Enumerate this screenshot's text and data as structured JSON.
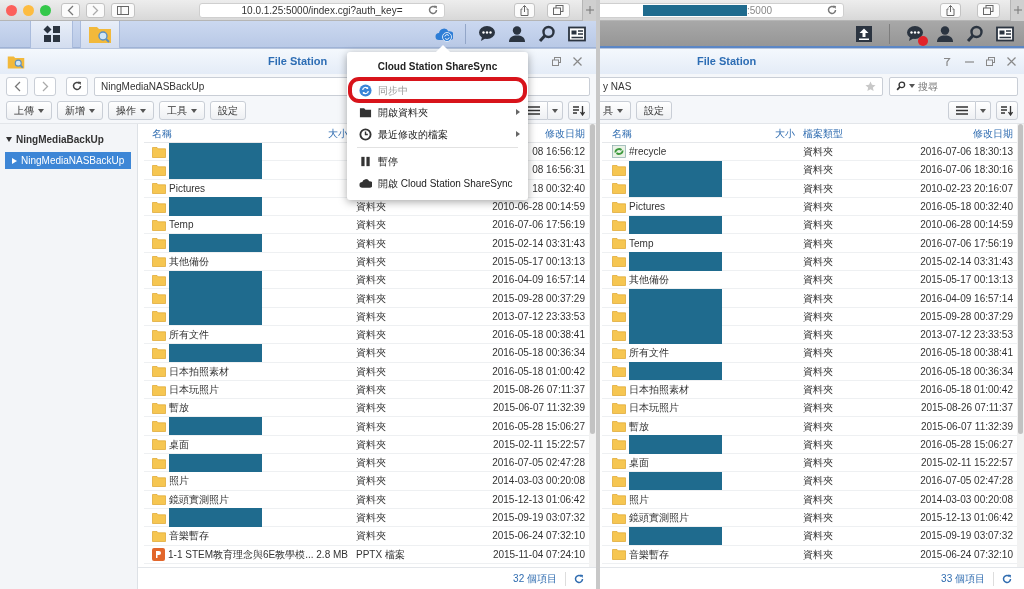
{
  "left_browser": {
    "address": "10.0.1.25:5000/index.cgi?auth_key="
  },
  "left_file_station": {
    "title": "File Station",
    "path": "NingMediaNASBackUp",
    "toolbar": [
      {
        "label": "上傳",
        "dropdown": true
      },
      {
        "label": "新增",
        "dropdown": true
      },
      {
        "label": "操作",
        "dropdown": true
      },
      {
        "label": "工具",
        "dropdown": true
      },
      {
        "label": "設定",
        "dropdown": false
      }
    ],
    "tree": [
      {
        "label": "NingMediaBackUp",
        "expanded": true,
        "selected": false,
        "children": [
          {
            "label": "NingMediaNASBackUp",
            "expanded": false,
            "selected": true
          }
        ]
      }
    ],
    "columns": [
      {
        "kind": "name",
        "label": "名稱"
      },
      {
        "kind": "size",
        "label": "大小"
      },
      {
        "kind": "modified",
        "label": "修改日期"
      }
    ],
    "rows": [
      {
        "kind": "folder",
        "redacted": true,
        "modified": "08 16:56:12"
      },
      {
        "kind": "folder",
        "redacted": true,
        "modified": "08 16:56:31"
      },
      {
        "kind": "folder",
        "redacted": false,
        "name": "Pictures",
        "modified": "18 00:32:40"
      },
      {
        "kind": "folder",
        "redacted": true,
        "type": "資料夾",
        "modified": "2010-06-28 00:14:59"
      },
      {
        "kind": "folder",
        "redacted": false,
        "name": "Temp",
        "type": "資料夾",
        "modified": "2016-07-06 17:56:19"
      },
      {
        "kind": "folder",
        "redacted": true,
        "type": "資料夾",
        "modified": "2015-02-14 03:31:43"
      },
      {
        "kind": "folder",
        "redacted": false,
        "name": "其他備份",
        "type": "資料夾",
        "modified": "2015-05-17 00:13:13"
      },
      {
        "kind": "folder",
        "redacted": true,
        "type": "資料夾",
        "modified": "2016-04-09 16:57:14"
      },
      {
        "kind": "folder",
        "redacted": true,
        "type": "資料夾",
        "modified": "2015-09-28 00:37:29"
      },
      {
        "kind": "folder",
        "redacted": true,
        "type": "資料夾",
        "modified": "2013-07-12 23:33:53"
      },
      {
        "kind": "folder",
        "redacted": false,
        "name": "所有文件",
        "type": "資料夾",
        "modified": "2016-05-18 00:38:41"
      },
      {
        "kind": "folder",
        "redacted": true,
        "type": "資料夾",
        "modified": "2016-05-18 00:36:34"
      },
      {
        "kind": "folder",
        "redacted": false,
        "name": "日本拍照素材",
        "type": "資料夾",
        "modified": "2016-05-18 01:00:42"
      },
      {
        "kind": "folder",
        "redacted": false,
        "name": "日本玩照片",
        "type": "資料夾",
        "modified": "2015-08-26 07:11:37"
      },
      {
        "kind": "folder",
        "redacted": false,
        "name": "暫放",
        "type": "資料夾",
        "modified": "2015-06-07 11:32:39"
      },
      {
        "kind": "folder",
        "redacted": true,
        "type": "資料夾",
        "modified": "2016-05-28 15:06:27"
      },
      {
        "kind": "folder",
        "redacted": false,
        "name": "桌面",
        "type": "資料夾",
        "modified": "2015-02-11 15:22:57"
      },
      {
        "kind": "folder",
        "redacted": true,
        "type": "資料夾",
        "modified": "2016-07-05 02:47:28"
      },
      {
        "kind": "folder",
        "redacted": false,
        "name": "照片",
        "type": "資料夾",
        "modified": "2014-03-03 00:20:08"
      },
      {
        "kind": "folder",
        "redacted": false,
        "name": "鏡頭實測照片",
        "type": "資料夾",
        "modified": "2015-12-13 01:06:42"
      },
      {
        "kind": "folder",
        "redacted": true,
        "type": "資料夾",
        "modified": "2015-09-19 03:07:32"
      },
      {
        "kind": "folder",
        "redacted": false,
        "name": "音樂暫存",
        "type": "資料夾",
        "modified": "2015-06-24 07:32:10"
      },
      {
        "kind": "pptx",
        "redacted": false,
        "name": "1-1 STEM教育理念與6E教學模...",
        "size": "2.8 MB",
        "type": "PPTX 檔案",
        "modified": "2015-11-04 07:24:10"
      }
    ],
    "footer": "32 個項目"
  },
  "sync_menu": {
    "title": "Cloud Station ShareSync",
    "items": [
      {
        "kind": "sync",
        "label": "同步中",
        "disabled": true,
        "highlighted": true,
        "submenu": false
      },
      {
        "kind": "folder",
        "label": "開啟資料夾",
        "disabled": false,
        "highlighted": false,
        "submenu": true
      },
      {
        "kind": "recent",
        "label": "最近修改的檔案",
        "disabled": false,
        "highlighted": false,
        "submenu": true
      },
      {
        "kind": "separator"
      },
      {
        "kind": "pause",
        "label": "暫停",
        "disabled": false,
        "highlighted": false,
        "submenu": false
      },
      {
        "kind": "cloud",
        "label": "開啟 Cloud Station ShareSync",
        "disabled": false,
        "highlighted": false,
        "submenu": false
      }
    ]
  },
  "right_browser": {
    "address": ":5000",
    "address_redacted": true
  },
  "right_taskbar": {
    "notification": true
  },
  "right_file_station": {
    "title": "File Station",
    "path": "y NAS",
    "search_placeholder": "搜尋",
    "toolbar": [
      {
        "label": "具",
        "dropdown": true
      },
      {
        "label": "設定",
        "dropdown": false
      }
    ],
    "columns": [
      {
        "kind": "name",
        "label": "名稱"
      },
      {
        "kind": "size",
        "label": "大小"
      },
      {
        "kind": "type",
        "label": "檔案類型"
      },
      {
        "kind": "modified",
        "label": "修改日期"
      }
    ],
    "rows": [
      {
        "kind": "recycle",
        "redacted": false,
        "name": "#recycle",
        "type": "資料夾",
        "modified": "2016-07-06 18:30:13"
      },
      {
        "kind": "folder",
        "redacted": true,
        "type": "資料夾",
        "modified": "2016-07-06 18:30:16"
      },
      {
        "kind": "folder",
        "redacted": true,
        "type": "資料夾",
        "modified": "2010-02-23 20:16:07"
      },
      {
        "kind": "folder",
        "redacted": false,
        "name": "Pictures",
        "type": "資料夾",
        "modified": "2016-05-18 00:32:40"
      },
      {
        "kind": "folder",
        "redacted": true,
        "type": "資料夾",
        "modified": "2010-06-28 00:14:59"
      },
      {
        "kind": "folder",
        "redacted": false,
        "name": "Temp",
        "type": "資料夾",
        "modified": "2016-07-06 17:56:19"
      },
      {
        "kind": "folder",
        "redacted": true,
        "type": "資料夾",
        "modified": "2015-02-14 03:31:43"
      },
      {
        "kind": "folder",
        "redacted": false,
        "name": "其他備份",
        "type": "資料夾",
        "modified": "2015-05-17 00:13:13"
      },
      {
        "kind": "folder",
        "redacted": true,
        "type": "資料夾",
        "modified": "2016-04-09 16:57:14"
      },
      {
        "kind": "folder",
        "redacted": true,
        "type": "資料夾",
        "modified": "2015-09-28 00:37:29"
      },
      {
        "kind": "folder",
        "redacted": true,
        "type": "資料夾",
        "modified": "2013-07-12 23:33:53"
      },
      {
        "kind": "folder",
        "redacted": false,
        "name": "所有文件",
        "type": "資料夾",
        "modified": "2016-05-18 00:38:41"
      },
      {
        "kind": "folder",
        "redacted": true,
        "type": "資料夾",
        "modified": "2016-05-18 00:36:34"
      },
      {
        "kind": "folder",
        "redacted": false,
        "name": "日本拍照素材",
        "type": "資料夾",
        "modified": "2016-05-18 01:00:42"
      },
      {
        "kind": "folder",
        "redacted": false,
        "name": "日本玩照片",
        "type": "資料夾",
        "modified": "2015-08-26 07:11:37"
      },
      {
        "kind": "folder",
        "redacted": false,
        "name": "暫放",
        "type": "資料夾",
        "modified": "2015-06-07 11:32:39"
      },
      {
        "kind": "folder",
        "redacted": true,
        "type": "資料夾",
        "modified": "2016-05-28 15:06:27"
      },
      {
        "kind": "folder",
        "redacted": false,
        "name": "桌面",
        "type": "資料夾",
        "modified": "2015-02-11 15:22:57"
      },
      {
        "kind": "folder",
        "redacted": true,
        "type": "資料夾",
        "modified": "2016-07-05 02:47:28"
      },
      {
        "kind": "folder",
        "redacted": false,
        "name": "照片",
        "type": "資料夾",
        "modified": "2014-03-03 00:20:08"
      },
      {
        "kind": "folder",
        "redacted": false,
        "name": "鏡頭實測照片",
        "type": "資料夾",
        "modified": "2015-12-13 01:06:42"
      },
      {
        "kind": "folder",
        "redacted": true,
        "type": "資料夾",
        "modified": "2015-09-19 03:07:32"
      },
      {
        "kind": "folder",
        "redacted": false,
        "name": "音樂暫存",
        "type": "資料夾",
        "modified": "2015-06-24 07:32:10"
      }
    ],
    "footer": "33 個項目"
  }
}
